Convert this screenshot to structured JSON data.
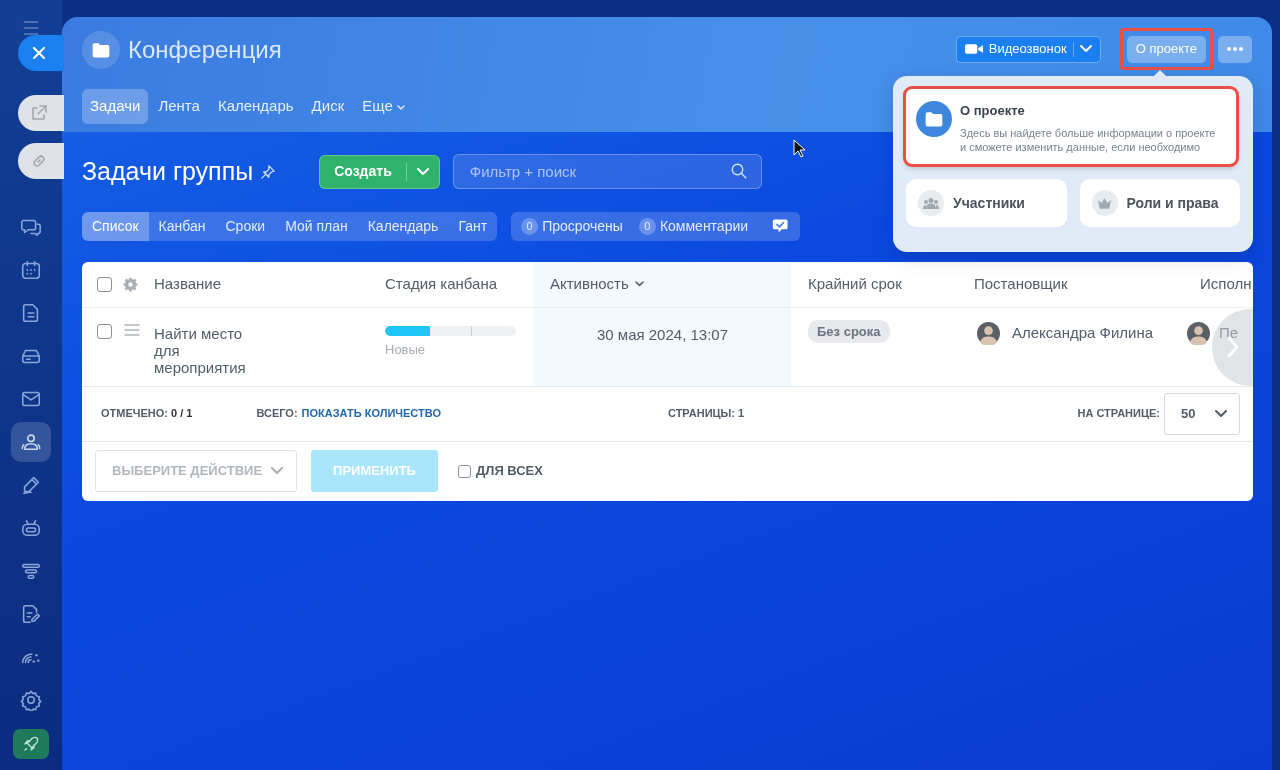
{
  "sidebar": {
    "items": [
      {
        "selected": false
      },
      {
        "selected": false
      },
      {
        "selected": false
      },
      {
        "selected": false
      },
      {
        "selected": false
      },
      {
        "selected": true
      },
      {
        "selected": false
      },
      {
        "selected": false
      },
      {
        "selected": false
      },
      {
        "selected": false
      },
      {
        "selected": false
      },
      {
        "selected": false
      }
    ]
  },
  "window": {
    "title": "Конференция",
    "tabs": [
      {
        "label": "Задачи",
        "selected": true
      },
      {
        "label": "Лента",
        "selected": false
      },
      {
        "label": "Календарь",
        "selected": false
      },
      {
        "label": "Диск",
        "selected": false
      },
      {
        "label": "Еще",
        "selected": false,
        "dropdown": true
      }
    ],
    "video_button": {
      "label": "Видеозвонок"
    },
    "about_button": {
      "label": "О проекте",
      "highlighted": true
    }
  },
  "about_menu": {
    "feature": {
      "title": "О проекте",
      "description": "Здесь вы найдете больше информации о проекте и сможете изменить данные, если необходимо",
      "highlighted": true
    },
    "shortcuts": [
      {
        "kind": "people",
        "label": "Участники"
      },
      {
        "kind": "crown",
        "label": "Роли и права"
      }
    ]
  },
  "page": {
    "title": "Задачи группы",
    "create_button": {
      "label": "Создать"
    },
    "search": {
      "placeholder": "Фильтр + поиск"
    },
    "views": [
      {
        "label": "Список",
        "selected": true
      },
      {
        "label": "Канбан",
        "selected": false
      },
      {
        "label": "Сроки",
        "selected": false
      },
      {
        "label": "Мой план",
        "selected": false
      },
      {
        "label": "Календарь",
        "selected": false
      },
      {
        "label": "Гант",
        "selected": false
      }
    ],
    "counters": [
      {
        "count": "0",
        "label": "Просрочены"
      },
      {
        "count": "0",
        "label": "Комментарии"
      }
    ]
  },
  "table": {
    "all_checked": false,
    "columns": [
      {
        "label": "Название",
        "sorted": false
      },
      {
        "label": "Стадия канбана",
        "sorted": false
      },
      {
        "label": "Активность",
        "sorted": true
      },
      {
        "label": "Крайний срок",
        "sorted": false
      },
      {
        "label": "Постановщик",
        "sorted": false
      },
      {
        "label": "Исполн",
        "sorted": false
      }
    ],
    "rows": [
      {
        "checked": false,
        "name": "Найти место для мероприятия",
        "stage": {
          "level": 0.34,
          "label": "Новые"
        },
        "activity": "30 мая 2024, 13:07",
        "deadline": "Без срока",
        "creator": "Александра Филина",
        "assignee": "Пе"
      }
    ],
    "footer": {
      "marked_label": "ОТМЕЧЕНО:",
      "marked_value": "0 / 1",
      "total_label": "ВСЕГО:",
      "total_link": "ПОКАЗАТЬ КОЛИЧЕСТВО",
      "pages_label": "СТРАНИЦЫ:",
      "pages_value": "1",
      "per_page_label": "НА СТРАНИЦЕ:",
      "per_page": "50"
    },
    "actions": {
      "select": {
        "placeholder": "ВЫБЕРИТЕ ДЕЙСТВИЕ"
      },
      "apply_button": {
        "label": "ПРИМЕНИТЬ",
        "disabled": true
      },
      "for_all": {
        "label": "ДЛЯ ВСЕХ",
        "checked": false
      }
    }
  }
}
